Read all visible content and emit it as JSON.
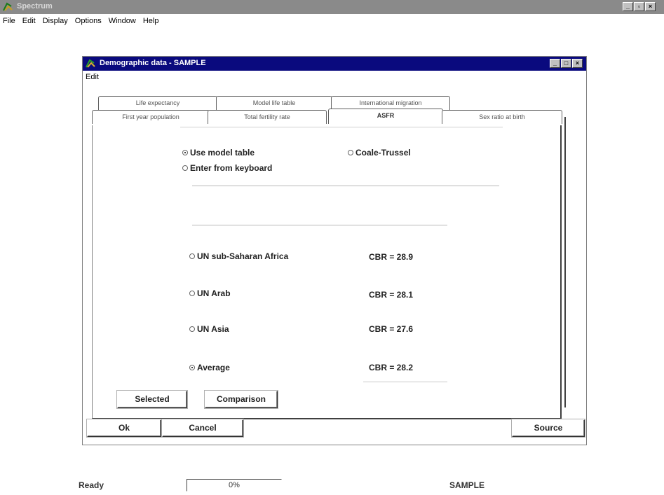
{
  "app": {
    "title": "Spectrum",
    "menu": [
      "File",
      "Edit",
      "Display",
      "Options",
      "Window",
      "Help"
    ]
  },
  "dialog": {
    "title": "Demographic data - SAMPLE",
    "menu": [
      "Edit"
    ],
    "tabs_back": [
      "Life expectancy",
      "Model life table",
      "International migration"
    ],
    "tabs_front": [
      "First year population",
      "Total fertility rate",
      "ASFR",
      "Sex ratio at birth"
    ],
    "active_tab": "ASFR",
    "options": {
      "use_model_table": "Use model table",
      "coale_trussel": "Coale-Trussel",
      "enter_from_keyboard": "Enter from keyboard"
    },
    "regions": [
      {
        "label": "UN sub-Saharan Africa",
        "cbr": "CBR = 28.9",
        "selected": false
      },
      {
        "label": "UN Arab",
        "cbr": "CBR = 28.1",
        "selected": false
      },
      {
        "label": "UN Asia",
        "cbr": "CBR = 27.6",
        "selected": false
      },
      {
        "label": "Average",
        "cbr": "CBR = 28.2",
        "selected": true
      }
    ],
    "buttons": {
      "selected": "Selected",
      "comparison": "Comparison",
      "ok": "Ok",
      "cancel": "Cancel",
      "source": "Source"
    }
  },
  "status": {
    "ready": "Ready",
    "progress": "0%",
    "project": "SAMPLE"
  },
  "colors": {
    "dialog_title_bg": "#0a0a7e",
    "app_title_bg": "#8a8a8a"
  }
}
